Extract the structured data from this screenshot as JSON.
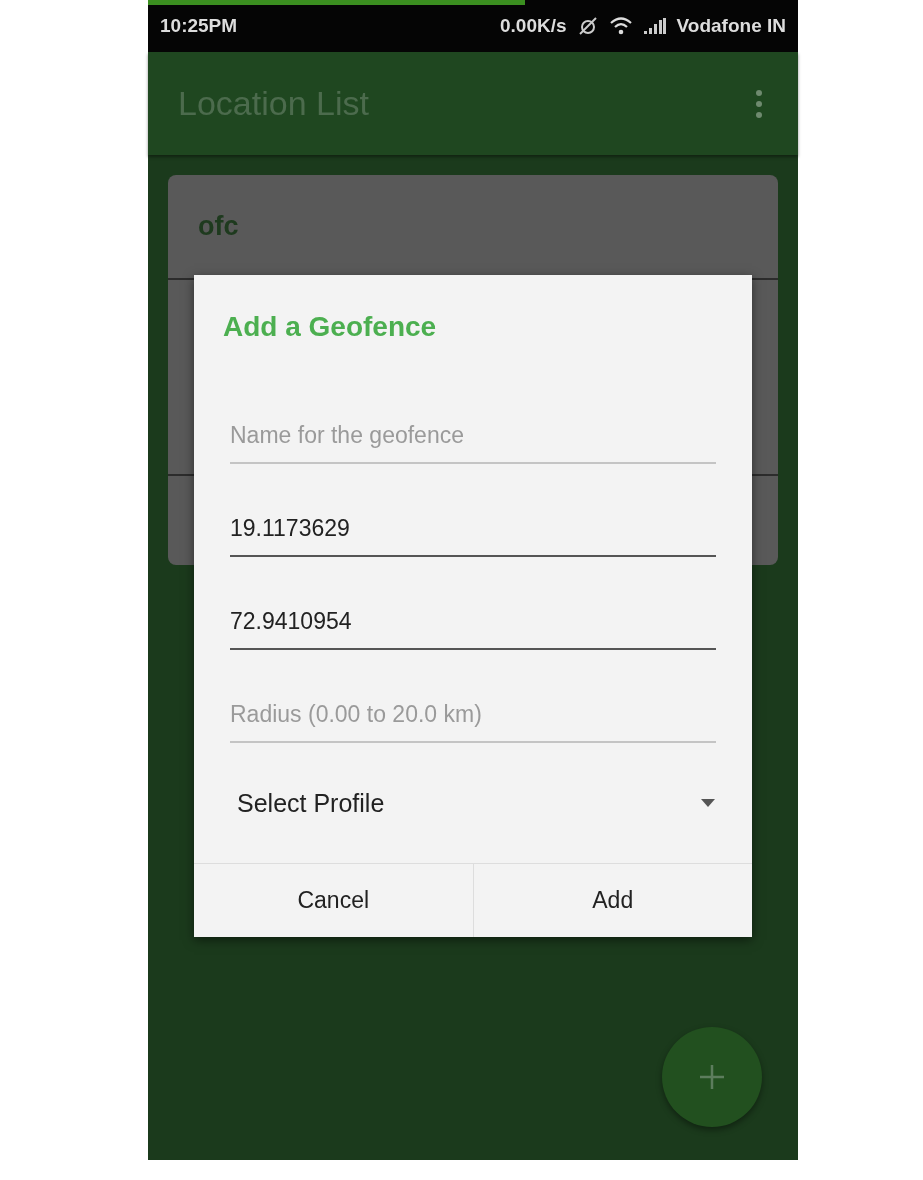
{
  "status_bar": {
    "time": "10:25PM",
    "speed": "0.00K/s",
    "carrier": "Vodafone IN",
    "progress": {
      "level": 0.58
    }
  },
  "app_bar": {
    "title": "Location List"
  },
  "list": {
    "items": [
      {
        "name": "ofc"
      }
    ]
  },
  "dialog": {
    "title": "Add a Geofence",
    "fields": [
      {
        "placeholder": "Name for the geofence"
      },
      {
        "value": "19.1173629"
      },
      {
        "value": "72.9410954"
      },
      {
        "placeholder": "Radius (0.00 to 20.0 km)"
      }
    ],
    "spinner": {
      "label": "Select Profile"
    },
    "buttons": [
      "Cancel",
      "Add"
    ]
  }
}
